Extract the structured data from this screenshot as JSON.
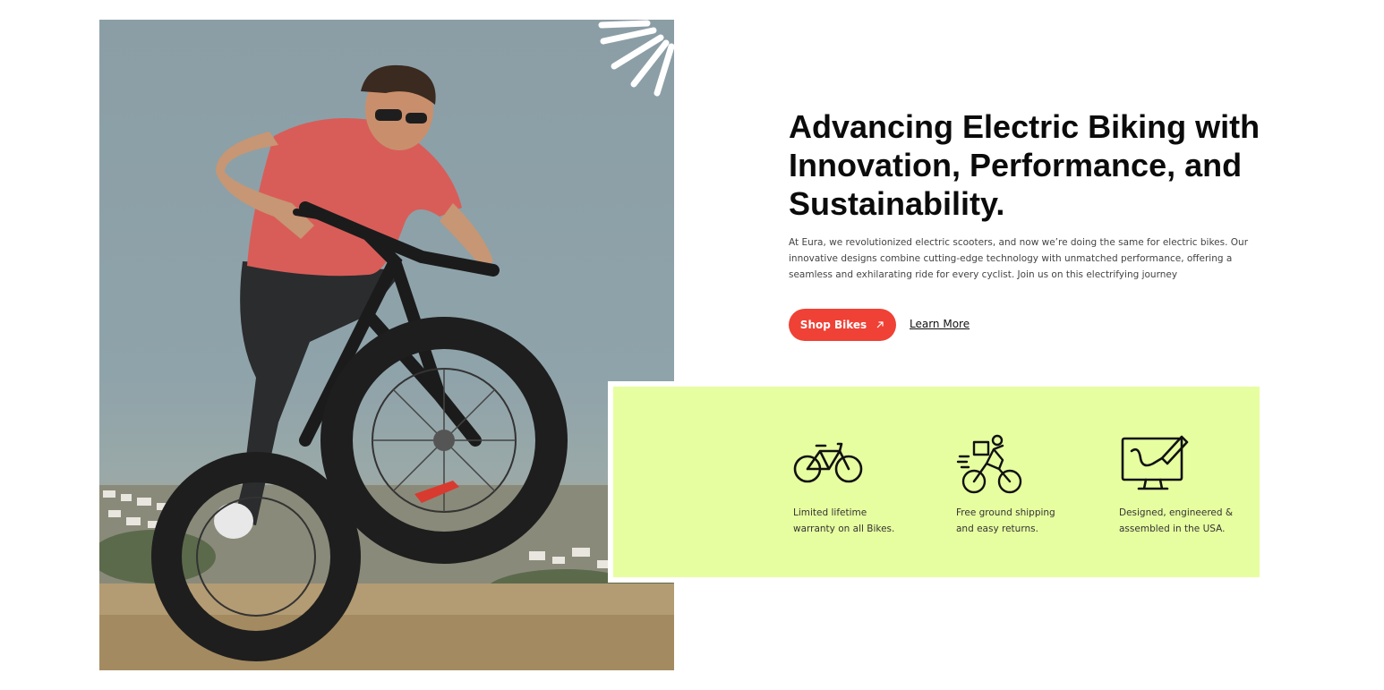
{
  "hero": {
    "title": "Advancing Electric Biking with Innovation, Performance, and Sustainability.",
    "description": "At Eura, we revolutionized electric scooters, and now we’re doing the same for electric bikes. Our innovative designs combine cutting-edge technology with unmatched performance, offering a seamless and exhilarating ride for every cyclist. Join us on this electrifying journey",
    "primary_cta": "Shop Bikes",
    "secondary_cta": "Learn More"
  },
  "features": [
    {
      "icon": "bicycle-icon",
      "text": "Limited lifetime\nwarranty on all Bikes."
    },
    {
      "icon": "delivery-rider-icon",
      "text": "Free ground shipping\nand easy returns."
    },
    {
      "icon": "monitor-design-icon",
      "text": "Designed, engineered &\nassembled in the USA."
    }
  ],
  "colors": {
    "accent": "#ef4136",
    "feature_bg": "#e7fea0",
    "text_dark": "#0b0b0b"
  }
}
